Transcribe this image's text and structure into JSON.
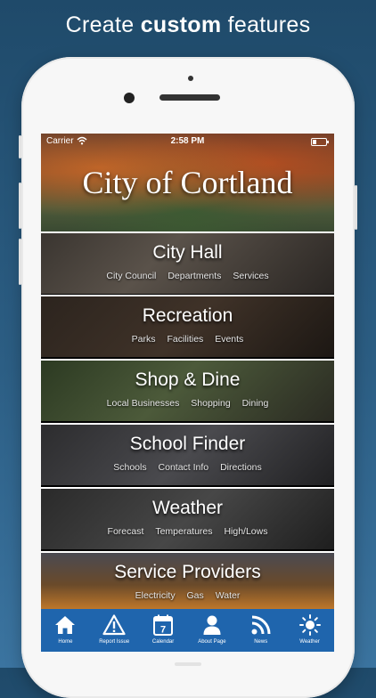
{
  "headline": {
    "prefix": "Create ",
    "bold": "custom",
    "suffix": " features"
  },
  "status_bar": {
    "carrier": "Carrier",
    "time": "2:58 PM"
  },
  "banner": {
    "title": "City of Cortland"
  },
  "tiles": [
    {
      "title": "City Hall",
      "subs": [
        "City Council",
        "Departments",
        "Services"
      ]
    },
    {
      "title": "Recreation",
      "subs": [
        "Parks",
        "Facilities",
        "Events"
      ]
    },
    {
      "title": "Shop & Dine",
      "subs": [
        "Local Businesses",
        "Shopping",
        "Dining"
      ]
    },
    {
      "title": "School Finder",
      "subs": [
        "Schools",
        "Contact Info",
        "Directions"
      ]
    },
    {
      "title": "Weather",
      "subs": [
        "Forecast",
        "Temperatures",
        "High/Lows"
      ]
    },
    {
      "title": "Service Providers",
      "subs": [
        "Electricity",
        "Gas",
        "Water"
      ]
    }
  ],
  "tabbar": {
    "items": [
      {
        "label": "Home",
        "icon": "home-icon"
      },
      {
        "label": "Report Issue",
        "icon": "warning-icon"
      },
      {
        "label": "Calendar",
        "icon": "calendar-icon",
        "day": "7"
      },
      {
        "label": "About Page",
        "icon": "person-icon"
      },
      {
        "label": "News",
        "icon": "rss-icon"
      },
      {
        "label": "Weather",
        "icon": "sun-icon"
      }
    ],
    "color": "#1f65ad"
  }
}
